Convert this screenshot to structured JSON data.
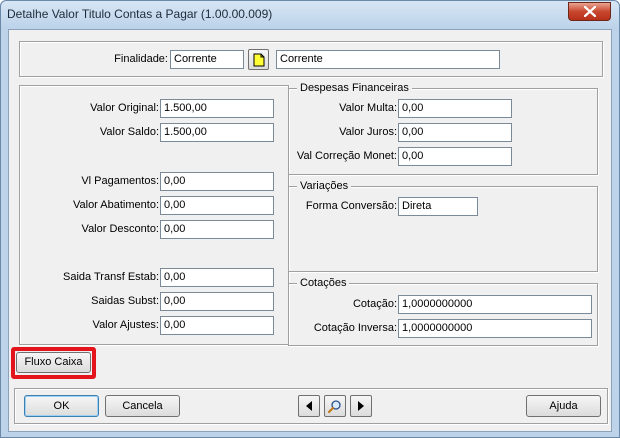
{
  "window": {
    "title": "Detalhe Valor Titulo Contas a Pagar (1.00.00.009)"
  },
  "finalidade": {
    "label": "Finalidade:",
    "code": "Corrente",
    "description": "Corrente"
  },
  "left_panel": {
    "valor_original": {
      "label": "Valor Original:",
      "value": "1.500,00"
    },
    "valor_saldo": {
      "label": "Valor Saldo:",
      "value": "1.500,00"
    },
    "vl_pagamentos": {
      "label": "Vl Pagamentos:",
      "value": "0,00"
    },
    "valor_abatimento": {
      "label": "Valor Abatimento:",
      "value": "0,00"
    },
    "valor_desconto": {
      "label": "Valor Desconto:",
      "value": "0,00"
    },
    "saida_transf_estab": {
      "label": "Saida Transf Estab:",
      "value": "0,00"
    },
    "saidas_subst": {
      "label": "Saidas Subst:",
      "value": "0,00"
    },
    "valor_ajustes": {
      "label": "Valor  Ajustes:",
      "value": "0,00"
    }
  },
  "despesas": {
    "title": "Despesas Financeiras",
    "valor_multa": {
      "label": "Valor Multa:",
      "value": "0,00"
    },
    "valor_juros": {
      "label": "Valor Juros:",
      "value": "0,00"
    },
    "val_correcao": {
      "label": "Val Correção Monet:",
      "value": "0,00"
    }
  },
  "variacoes": {
    "title": "Variações",
    "forma_conversao": {
      "label": "Forma Conversão:",
      "value": "Direta"
    }
  },
  "cotacoes": {
    "title": "Cotações",
    "cotacao": {
      "label": "Cotação:",
      "value": "1,0000000000"
    },
    "cotacao_inversa": {
      "label": "Cotação Inversa:",
      "value": "1,0000000000"
    }
  },
  "buttons": {
    "fluxo_caixa": "Fluxo Caixa",
    "ok": "OK",
    "cancela": "Cancela",
    "ajuda": "Ajuda"
  },
  "colors": {
    "highlight": "#e3141b",
    "zoom_icon": "#ffff33"
  },
  "icons": {
    "close": "close-icon",
    "zoom": "zoom-lookup-icon",
    "prev": "arrow-left-icon",
    "next": "arrow-right-icon",
    "search": "magnifier-icon"
  }
}
